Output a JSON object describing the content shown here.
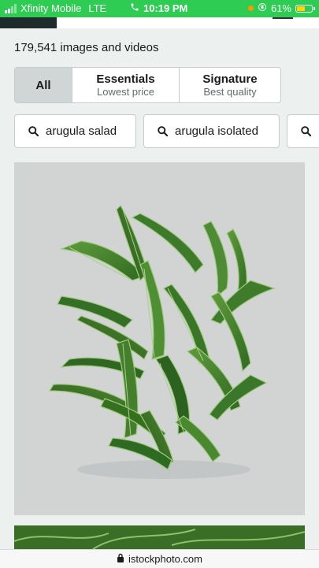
{
  "status_bar": {
    "carrier": "Xfinity Mobile",
    "network": "LTE",
    "time": "10:19 PM",
    "battery_percent": "61%",
    "battery_level": 0.61,
    "battery_color": "#ffd60a",
    "bar_color": "#2ecc52"
  },
  "results": {
    "count_text": "179,541 images and videos"
  },
  "filters": [
    {
      "title": "All",
      "subtitle": "",
      "selected": true
    },
    {
      "title": "Essentials",
      "subtitle": "Lowest price",
      "selected": false
    },
    {
      "title": "Signature",
      "subtitle": "Best quality",
      "selected": false
    }
  ],
  "suggestions": [
    {
      "label": "arugula salad",
      "icon": "search-icon"
    },
    {
      "label": "arugula isolated",
      "icon": "search-icon"
    },
    {
      "label": "",
      "icon": "search-icon"
    }
  ],
  "url_bar": {
    "domain": "istockphoto.com",
    "icon": "lock-icon"
  }
}
